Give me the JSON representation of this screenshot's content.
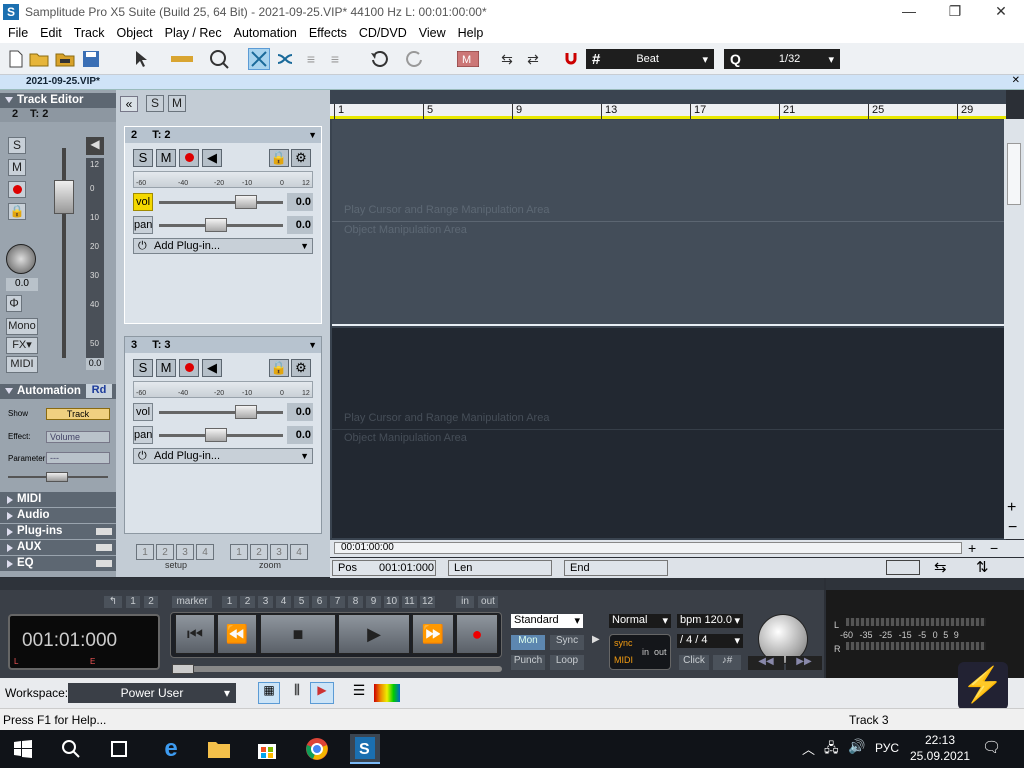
{
  "window": {
    "title": "Samplitude Pro X5 Suite (Build 25, 64 Bit)  -  2021-09-25.VIP*   44100 Hz L: 00:01:00:00*",
    "minimize": "—",
    "maximize": "❐",
    "close": "✕"
  },
  "menu": [
    "File",
    "Edit",
    "Track",
    "Object",
    "Play / Rec",
    "Automation",
    "Effects",
    "CD/DVD",
    "View",
    "Help"
  ],
  "toolbar": {
    "snap_label": "Beat",
    "quantize_prefix": "Q",
    "quantize_label": "1/32"
  },
  "doc_tab": {
    "label": "2021-09-25.VIP*",
    "close": "✕"
  },
  "track_editor": {
    "title": "Track Editor",
    "track_num": "2",
    "track_name": "T: 2",
    "s": "S",
    "m": "M",
    "pan_value": "0.0",
    "mono": "Mono",
    "fx": "FX",
    "midi": "MIDI",
    "phase": "Φ",
    "meter_scale": [
      "12",
      "0",
      "10",
      "20",
      "30",
      "40",
      "50",
      "0.0"
    ],
    "meter_value": "0.0"
  },
  "automation": {
    "title": "Automation",
    "rd": "Rd",
    "show_label": "Show",
    "show_value": "Track",
    "effect_label": "Effect:",
    "effect_value": "Volume",
    "parameter_label": "Parameter",
    "parameter_value": "---"
  },
  "sections": [
    "MIDI",
    "Audio",
    "Plug-ins",
    "AUX",
    "EQ"
  ],
  "tracks": [
    {
      "num": "2",
      "name": "T: 2",
      "s": "S",
      "m": "M",
      "vol_label": "vol",
      "vol": "0.0",
      "pan_label": "pan",
      "pan": "0.0",
      "plugin": "Add Plug-in..."
    },
    {
      "num": "3",
      "name": "T: 3",
      "s": "S",
      "m": "M",
      "vol_label": "vol",
      "vol": "0.0",
      "pan_label": "pan",
      "pan": "0.0",
      "plugin": "Add Plug-in..."
    }
  ],
  "meter_scale_labels": [
    "-60",
    "-40",
    "-20",
    "-10",
    "0",
    "12"
  ],
  "ruler": [
    "1",
    "5",
    "9",
    "13",
    "17",
    "21",
    "25",
    "29"
  ],
  "lane_texts": {
    "cursor_area": "Play Cursor and Range Manipulation Area",
    "object_area": "Object Manipulation Area"
  },
  "setup": {
    "label": "setup",
    "buttons": [
      "1",
      "2",
      "3",
      "4"
    ]
  },
  "zoom": {
    "label": "zoom",
    "buttons": [
      "1",
      "2",
      "3",
      "4"
    ]
  },
  "timeline": {
    "time": "00:01:00:00"
  },
  "position": {
    "pos_label": "Pos",
    "pos_value": "001:01:000",
    "len_label": "Len",
    "end_label": "End"
  },
  "transport": {
    "markers": [
      "1",
      "2"
    ],
    "marker_label": "marker",
    "marker_nums": [
      "1",
      "2",
      "3",
      "4",
      "5",
      "6",
      "7",
      "8",
      "9",
      "10",
      "11",
      "12"
    ],
    "in": "in",
    "out": "out",
    "display": "001:01:000",
    "display_l": "L",
    "display_e": "E",
    "mode": "Standard",
    "mon": "Mon",
    "sync": "Sync",
    "punch": "Punch",
    "loop": "Loop",
    "normal": "Normal",
    "bpm": "bpm  120.0",
    "signature": "/   4 / 4",
    "sync_small": "sync",
    "midi_small": "MIDI",
    "in_small": "in",
    "out_small": "out",
    "click": "Click"
  },
  "master_meter": {
    "l": "L",
    "r": "R",
    "scale": [
      "-60",
      "-35",
      "-25",
      "-15",
      "-5",
      "0",
      "5",
      "9"
    ]
  },
  "workspace": {
    "label": "Workspace:",
    "value": "Power User"
  },
  "status": {
    "help": "Press F1 for Help...",
    "track": "Track 3"
  },
  "taskbar": {
    "lang": "РУС",
    "time": "22:13",
    "date": "25.09.2021"
  }
}
